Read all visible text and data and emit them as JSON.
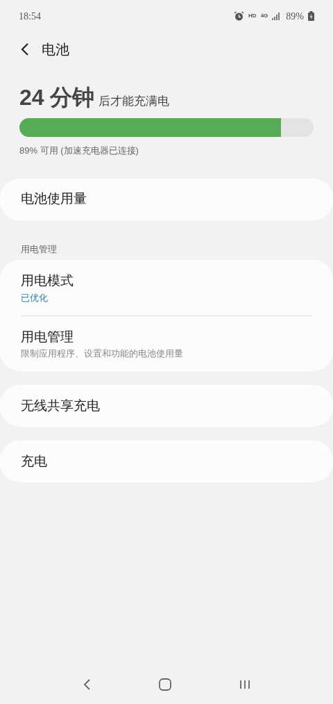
{
  "status_bar": {
    "time": "18:54",
    "network_labels": [
      "HD",
      "4G"
    ],
    "battery": "89%"
  },
  "header": {
    "title": "电池"
  },
  "charge": {
    "time_value": "24 分钟",
    "suffix": "后才能充满电",
    "level": 0.89,
    "caption": "89% 可用 (加速充电器已连接)"
  },
  "groups": [
    {
      "items": [
        {
          "title": "电池使用量"
        }
      ]
    },
    {
      "header": "用电管理",
      "items": [
        {
          "title": "用电模式",
          "subtitle": "已优化",
          "kind": "status"
        },
        {
          "title": "用电管理",
          "subtitle": "限制应用程序、设置和功能的电池使用量",
          "kind": "description"
        }
      ]
    },
    {
      "items": [
        {
          "title": "无线共享充电"
        }
      ]
    },
    {
      "items": [
        {
          "title": "充电"
        }
      ]
    }
  ]
}
